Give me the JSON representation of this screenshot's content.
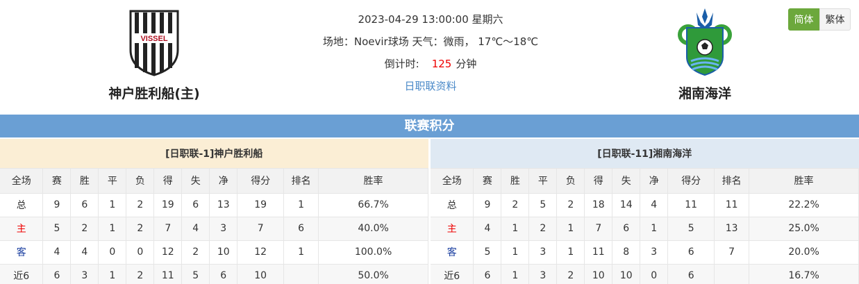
{
  "match": {
    "datetime": "2023-04-29 13:00:00 星期六",
    "venue_weather": "场地：Noevir球场 天气：微雨， 17℃～18℃",
    "countdown_label": "倒计时:",
    "countdown_value": "125",
    "countdown_unit": "分钟",
    "league_link": "日职联资料"
  },
  "home_team": {
    "name": "神户胜利船(主)",
    "logo_text": "VISSEL"
  },
  "away_team": {
    "name": "湘南海洋"
  },
  "lang": {
    "simplified": "简体",
    "traditional": "繁体"
  },
  "section_title": "联赛积分",
  "columns": [
    "全场",
    "赛",
    "胜",
    "平",
    "负",
    "得",
    "失",
    "净",
    "得分",
    "排名",
    "胜率"
  ],
  "home_table": {
    "title": "[日职联-1]神户胜利船",
    "rows": [
      {
        "label": "总",
        "played": "9",
        "w": "6",
        "d": "1",
        "l": "2",
        "gf": "19",
        "ga": "6",
        "gd": "13",
        "pts": "19",
        "rank": "1",
        "rate": "66.7%"
      },
      {
        "label": "主",
        "played": "5",
        "w": "2",
        "d": "1",
        "l": "2",
        "gf": "7",
        "ga": "4",
        "gd": "3",
        "pts": "7",
        "rank": "6",
        "rate": "40.0%"
      },
      {
        "label": "客",
        "played": "4",
        "w": "4",
        "d": "0",
        "l": "0",
        "gf": "12",
        "ga": "2",
        "gd": "10",
        "pts": "12",
        "rank": "1",
        "rate": "100.0%"
      },
      {
        "label": "近6",
        "played": "6",
        "w": "3",
        "d": "1",
        "l": "2",
        "gf": "11",
        "ga": "5",
        "gd": "6",
        "pts": "10",
        "rank": "",
        "rate": "50.0%"
      }
    ]
  },
  "away_table": {
    "title": "[日职联-11]湘南海洋",
    "rows": [
      {
        "label": "总",
        "played": "9",
        "w": "2",
        "d": "5",
        "l": "2",
        "gf": "18",
        "ga": "14",
        "gd": "4",
        "pts": "11",
        "rank": "11",
        "rate": "22.2%"
      },
      {
        "label": "主",
        "played": "4",
        "w": "1",
        "d": "2",
        "l": "1",
        "gf": "7",
        "ga": "6",
        "gd": "1",
        "pts": "5",
        "rank": "13",
        "rate": "25.0%"
      },
      {
        "label": "客",
        "played": "5",
        "w": "1",
        "d": "3",
        "l": "1",
        "gf": "11",
        "ga": "8",
        "gd": "3",
        "pts": "6",
        "rank": "7",
        "rate": "20.0%"
      },
      {
        "label": "近6",
        "played": "6",
        "w": "1",
        "d": "3",
        "l": "2",
        "gf": "10",
        "ga": "10",
        "gd": "0",
        "pts": "6",
        "rank": "",
        "rate": "16.7%"
      }
    ]
  }
}
